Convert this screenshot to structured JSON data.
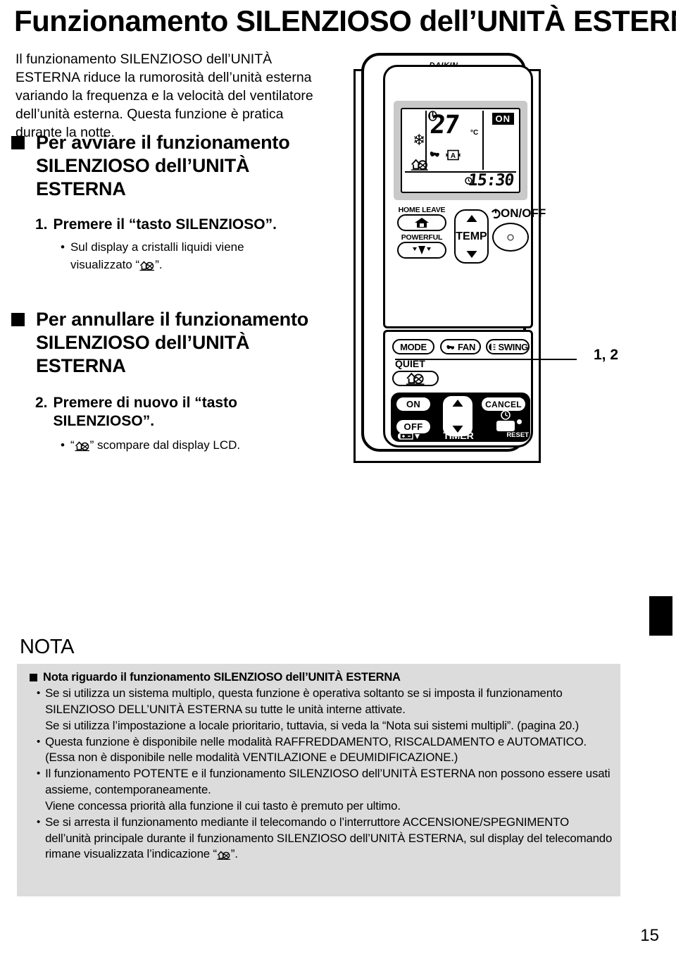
{
  "page": {
    "title": "Funzionamento SILENZIOSO dell’UNITÀ ESTERNA",
    "number": "15"
  },
  "intro": {
    "text": "Il funzionamento SILENZIOSO dell’UNITÀ ESTERNA riduce la rumorosità dell’unità esterna variando la frequenza e la velocità del ventilatore dell’unità esterna. Questa funzione è pratica durante la notte."
  },
  "sections": [
    {
      "heading": "Per avviare il funzionamento SILENZIOSO dell’UNITÀ ESTERNA",
      "step_number": "1.",
      "step_text": "Premere il “tasto SILENZIOSO”.",
      "bullet": "•",
      "sub_prefix": "Sul display a cristalli liquidi viene",
      "sub_line2_before": "visualizzato “",
      "sub_line2_after": "”."
    },
    {
      "heading": "Per annullare il funzionamento SILENZIOSO dell’UNITÀ ESTERNA",
      "step_number": "2.",
      "step_text": "Premere di nuovo il “tasto SILENZIOSO”.",
      "bullet": "•",
      "sub_line2_before": "“",
      "sub_line2_after": "” scompare dal display LCD."
    }
  ],
  "remote": {
    "brand": "DAIKIN",
    "callout_label": "1, 2",
    "lcd": {
      "temperature": "27",
      "unit": "°C",
      "on_badge": "ON",
      "clock": "15:30",
      "mode_icon": "snowflake-icon",
      "power_icon": "power-icon",
      "fan_icon": "fan-icon",
      "fan_speed": "A",
      "quiet_icon": "quiet-outdoor-unit-icon",
      "timer_icon": "clock-icon"
    },
    "buttons": {
      "home_leave": "HOME LEAVE",
      "powerful": "POWERFUL",
      "temp": "TEMP",
      "onoff": "ON/OFF",
      "mode": "MODE",
      "fan": "FAN",
      "swing": "SWING",
      "quiet": "QUIET",
      "timer_on": "ON",
      "timer_off": "OFF",
      "timer_cancel": "CANCEL",
      "timer": "TIMER",
      "reset": "RESET"
    }
  },
  "nota": {
    "title": "NOTA",
    "heading": "Nota riguardo il funzionamento SILENZIOSO dell’UNITÀ ESTERNA",
    "bullet": "•",
    "items": [
      "Se si utilizza un sistema multiplo, questa funzione è operativa soltanto se si imposta il funzionamento SILENZIOSO DELL’UNITÀ ESTERNA su tutte le unità interne attivate.\nSe si utilizza l’impostazione a locale prioritario, tuttavia, si veda la “Nota sui sistemi multipli”. (pagina 20.)",
      "Questa funzione è disponibile nelle modalità RAFFREDDAMENTO, RISCALDAMENTO e AUTOMATICO.\n(Essa non è disponibile nelle modalità VENTILAZIONE e DEUMIDIFICAZIONE.)",
      "Il funzionamento POTENTE e il funzionamento SILENZIOSO dell’UNITÀ ESTERNA non possono essere usati assieme, contemporaneamente.\nViene concessa priorità alla funzione il cui tasto è premuto per ultimo."
    ],
    "last_item_before_icon": "Se si arresta il funzionamento mediante il telecomando o l’interruttore ACCENSIONE/SPEGNIMENTO dell’unità principale durante il funzionamento SILENZIOSO dell’UNITÀ ESTERNA, sul display del telecomando rimane visualizzata l’indicazione “",
    "last_item_after_icon": "”."
  },
  "colors": {
    "text": "#000000",
    "note_background": "#dcdcdc",
    "lcd_bezel": "#c9c9c9",
    "page_background": "#ffffff"
  }
}
